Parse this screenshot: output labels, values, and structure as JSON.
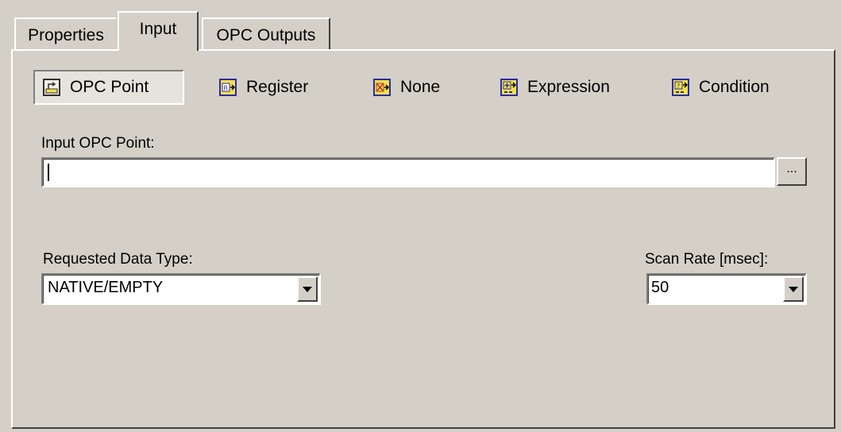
{
  "tabs": [
    {
      "label": "Properties",
      "active": false
    },
    {
      "label": "Input",
      "active": true
    },
    {
      "label": "OPC Outputs",
      "active": false
    }
  ],
  "input_source": {
    "options": [
      {
        "label": "OPC Point",
        "icon": "opc-point-icon",
        "selected": true
      },
      {
        "label": "Register",
        "icon": "register-icon",
        "selected": false
      },
      {
        "label": "None",
        "icon": "none-icon",
        "selected": false
      },
      {
        "label": "Expression",
        "icon": "expression-icon",
        "selected": false
      },
      {
        "label": "Condition",
        "icon": "condition-icon",
        "selected": false
      }
    ]
  },
  "input_opc_point": {
    "label": "Input OPC Point:",
    "value": "",
    "browse_label": "..."
  },
  "requested_data_type": {
    "label": "Requested Data Type:",
    "value": "NATIVE/EMPTY"
  },
  "scan_rate": {
    "label": "Scan Rate [msec]:",
    "value": "50"
  },
  "colors": {
    "face": "#d4d0c8",
    "icon_fill": "#f4e24a",
    "icon_border": "#2a2aa8"
  }
}
